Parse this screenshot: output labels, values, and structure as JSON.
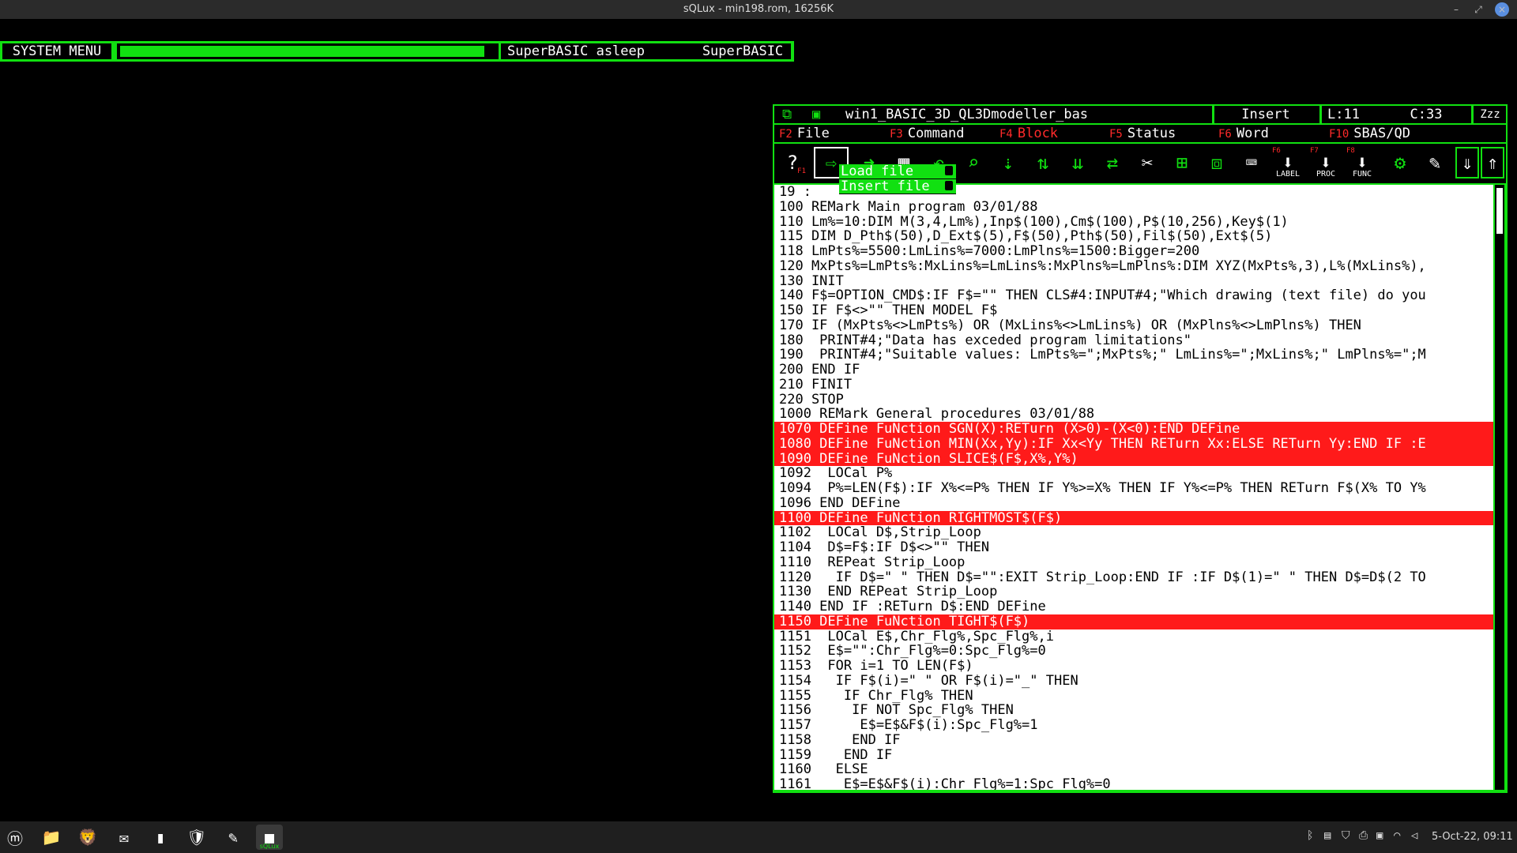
{
  "window": {
    "title": "sQLux - min198.rom, 16256K",
    "min": "–",
    "max": "⤢",
    "close": "×"
  },
  "qlbar": {
    "system_menu": "SYSTEM MENU",
    "progress": 0.97,
    "status": "SuperBASIC asleep",
    "title": "SuperBASIC"
  },
  "editor": {
    "header": {
      "icon1": "⧉",
      "icon2": "▣",
      "filename": "win1_BASIC_3D_QL3Dmodeller_bas",
      "mode": "Insert",
      "line": "L:11",
      "col": "C:33",
      "sleep": "Zzz"
    },
    "menu": [
      {
        "key": "F2",
        "label": "File",
        "active": false
      },
      {
        "key": "F3",
        "label": "Command",
        "active": false
      },
      {
        "key": "F4",
        "label": "Block",
        "active": true
      },
      {
        "key": "F5",
        "label": "Status",
        "active": false
      },
      {
        "key": "F6",
        "label": "Word",
        "active": false
      },
      {
        "key": "F10",
        "label": "SBAS/QD",
        "active": false
      }
    ],
    "toolbar": {
      "help": "?",
      "help_key": "F1",
      "label": "LABEL",
      "proc": "PROC",
      "func": "FUNC",
      "label_key": "F6",
      "proc_key": "F7",
      "func_key": "F8"
    },
    "file_popup": {
      "load": "Load file",
      "insert": "Insert file"
    },
    "lines": [
      {
        "text": "19 :",
        "hl": false
      },
      {
        "text": "100 REMark Main program 03/01/88",
        "hl": false
      },
      {
        "text": "110 Lm%=10:DIM M(3,4,Lm%),Inp$(100),Cm$(100),P$(10,256),Key$(1)",
        "hl": false
      },
      {
        "text": "115 DIM D_Pth$(50),D_Ext$(5),F$(50),Pth$(50),Fil$(50),Ext$(5)",
        "hl": false
      },
      {
        "text": "118 LmPts%=5500:LmLins%=7000:LmPlns%=1500:Bigger=200",
        "hl": false
      },
      {
        "text": "120 MxPts%=LmPts%:MxLins%=LmLins%:MxPlns%=LmPlns%:DIM XYZ(MxPts%,3),L%(MxLins%),",
        "hl": false
      },
      {
        "text": "130 INIT",
        "hl": false
      },
      {
        "text": "140 F$=OPTION_CMD$:IF F$=\"\" THEN CLS#4:INPUT#4;\"Which drawing (text file) do you",
        "hl": false
      },
      {
        "text": "150 IF F$<>\"\" THEN MODEL F$",
        "hl": false
      },
      {
        "text": "170 IF (MxPts%<>LmPts%) OR (MxLins%<>LmLins%) OR (MxPlns%<>LmPlns%) THEN",
        "hl": false
      },
      {
        "text": "180  PRINT#4;\"Data has exceded program limitations\"",
        "hl": false
      },
      {
        "text": "190  PRINT#4;\"Suitable values: LmPts%=\";MxPts%;\" LmLins%=\";MxLins%;\" LmPlns%=\";M",
        "hl": false
      },
      {
        "text": "200 END IF",
        "hl": false
      },
      {
        "text": "210 FINIT",
        "hl": false
      },
      {
        "text": "220 STOP",
        "hl": false
      },
      {
        "text": "1000 REMark General procedures 03/01/88",
        "hl": false
      },
      {
        "text": "1070 DEFine FuNction SGN(X):RETurn (X>0)-(X<0):END DEFine",
        "hl": true
      },
      {
        "text": "1080 DEFine FuNction MIN(Xx,Yy):IF Xx<Yy THEN RETurn Xx:ELSE RETurn Yy:END IF :E",
        "hl": true
      },
      {
        "text": "1090 DEFine FuNction SLICE$(F$,X%,Y%)",
        "hl": true
      },
      {
        "text": "1092  LOCal P%",
        "hl": false
      },
      {
        "text": "1094  P%=LEN(F$):IF X%<=P% THEN IF Y%>=X% THEN IF Y%<=P% THEN RETurn F$(X% TO Y%",
        "hl": false
      },
      {
        "text": "1096 END DEFine",
        "hl": false
      },
      {
        "text": "1100 DEFine FuNction RIGHTMOST$(F$)",
        "hl": true
      },
      {
        "text": "1102  LOCal D$,Strip_Loop",
        "hl": false
      },
      {
        "text": "1104  D$=F$:IF D$<>\"\" THEN",
        "hl": false
      },
      {
        "text": "1110  REPeat Strip_Loop",
        "hl": false
      },
      {
        "text": "1120   IF D$=\" \" THEN D$=\"\":EXIT Strip_Loop:END IF :IF D$(1)=\" \" THEN D$=D$(2 TO",
        "hl": false
      },
      {
        "text": "1130  END REPeat Strip_Loop",
        "hl": false
      },
      {
        "text": "1140 END IF :RETurn D$:END DEFine",
        "hl": false
      },
      {
        "text": "1150 DEFine FuNction TIGHT$(F$)",
        "hl": true
      },
      {
        "text": "1151  LOCal E$,Chr_Flg%,Spc_Flg%,i",
        "hl": false
      },
      {
        "text": "1152  E$=\"\":Chr_Flg%=0:Spc_Flg%=0",
        "hl": false
      },
      {
        "text": "1153  FOR i=1 TO LEN(F$)",
        "hl": false
      },
      {
        "text": "1154   IF F$(i)=\" \" OR F$(i)=\"_\" THEN",
        "hl": false
      },
      {
        "text": "1155    IF Chr_Flg% THEN",
        "hl": false
      },
      {
        "text": "1156     IF NOT Spc_Flg% THEN",
        "hl": false
      },
      {
        "text": "1157      E$=E$&F$(i):Spc_Flg%=1",
        "hl": false
      },
      {
        "text": "1158     END IF",
        "hl": false
      },
      {
        "text": "1159    END IF",
        "hl": false
      },
      {
        "text": "1160   ELSE",
        "hl": false
      },
      {
        "text": "1161    E$=E$&F$(i):Chr_Flg%=1:Spc_Flg%=0",
        "hl": false
      }
    ]
  },
  "taskbar": {
    "apps": [
      {
        "name": "mint-menu",
        "glyph": "ⓜ"
      },
      {
        "name": "files",
        "glyph": "📁"
      },
      {
        "name": "brave",
        "glyph": "🦁"
      },
      {
        "name": "thunderbird",
        "glyph": "✉"
      },
      {
        "name": "terminal",
        "glyph": "▮"
      },
      {
        "name": "vpn",
        "glyph": "🛡"
      },
      {
        "name": "text-editor",
        "glyph": "✎"
      },
      {
        "name": "sqlux",
        "glyph": "■",
        "label": "sQLux"
      }
    ],
    "clock": "5-Oct-22, 09:11"
  }
}
